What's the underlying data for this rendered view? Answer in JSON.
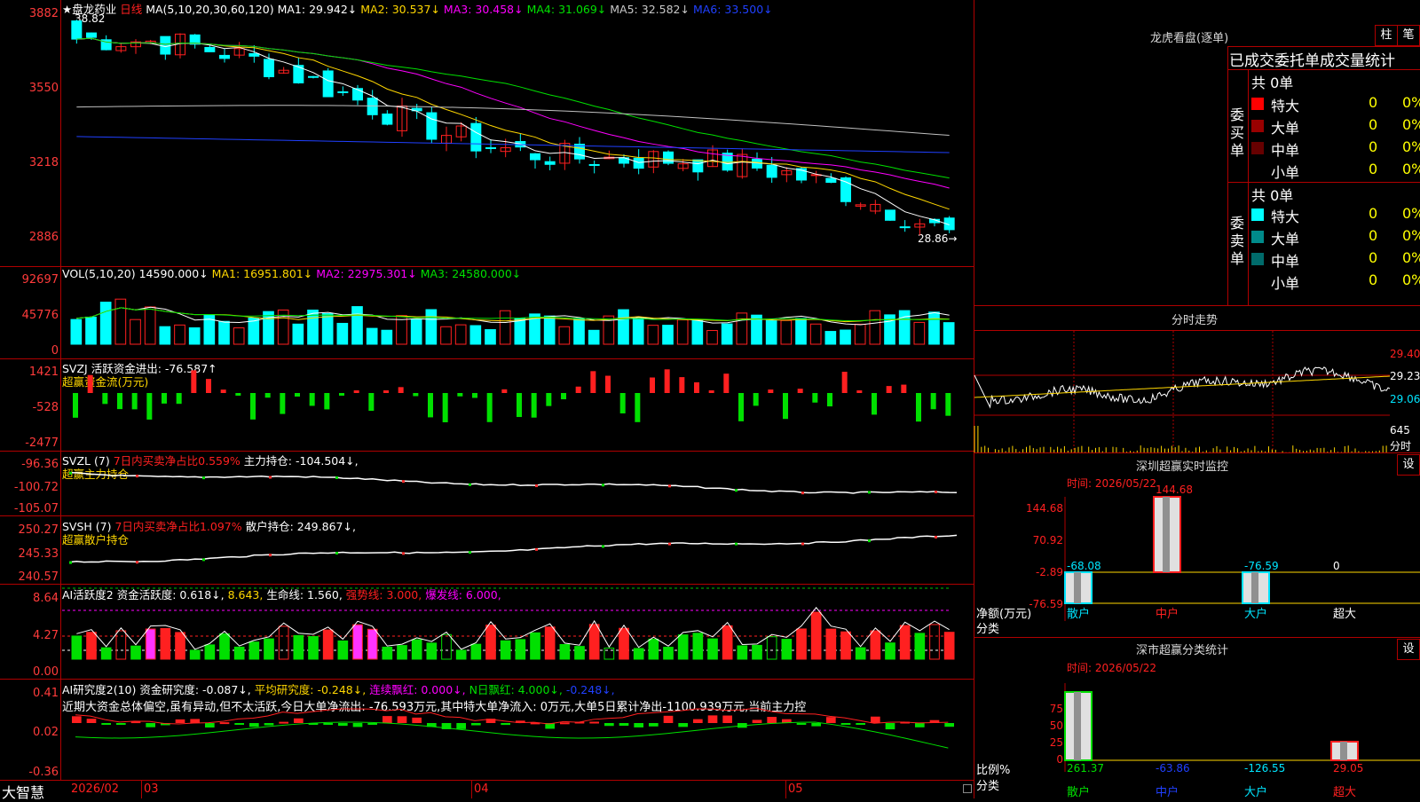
{
  "main_chart": {
    "stock_name": "★盘龙药业",
    "period": "日线",
    "ma_label": "MA(5,10,20,30,60,120)",
    "ma": [
      {
        "label": "MA1: 29.942↓",
        "color": "#ffffff"
      },
      {
        "label": "MA2: 30.537↓",
        "color": "#ffd700"
      },
      {
        "label": "MA3: 30.458↓",
        "color": "#ff00ff"
      },
      {
        "label": "MA4: 31.069↓",
        "color": "#00e000"
      },
      {
        "label": "MA5: 32.582↓",
        "color": "#c8c8c8"
      },
      {
        "label": "MA6: 33.500↓",
        "color": "#2040ff"
      }
    ],
    "yaxis": [
      "3882",
      "3550",
      "3218",
      "2886"
    ],
    "high_note": "38.82",
    "low_note": "28.86→"
  },
  "vol": {
    "label": "VOL(5,10,20)",
    "value": "14590.000↓",
    "ma1": "MA1: 16951.801↓",
    "ma2": "MA2: 22975.301↓",
    "ma3": "MA3: 24580.000↓",
    "yaxis": [
      "92697",
      "45776",
      "0"
    ]
  },
  "svzj": {
    "label": "SVZJ",
    "text": "活跃资金进出: -76.587↑",
    "sub": "超赢资金流(万元)",
    "yaxis": [
      "1421",
      "-528",
      "-2477"
    ]
  },
  "svzl": {
    "label": "SVZL (7)",
    "text1": "7日内买卖净占比0.559%",
    "text2": "主力持仓: -104.504↓,",
    "sub": "超赢主力持仓",
    "yaxis": [
      "-96.36",
      "-100.72",
      "-105.07"
    ]
  },
  "svsh": {
    "label": "SVSH (7)",
    "text1": "7日内买卖净占比1.097%",
    "text2": "散户持仓: 249.867↓,",
    "sub": "超赢散户持仓",
    "yaxis": [
      "250.27",
      "245.33",
      "240.57"
    ]
  },
  "ai1": {
    "label": "AI活跃度2",
    "t1": "资金活跃度: 0.618↓,",
    "t2": "8.643,",
    "t3": "生命线: 1.560,",
    "t4": "强势线: 3.000,",
    "t5": "爆发线: 6.000,",
    "yaxis": [
      "8.64",
      "4.27",
      "0.00"
    ]
  },
  "ai2": {
    "label": "AI研究度2(10)",
    "t1": "资金研究度: -0.087↓,",
    "t2": "平均研究度: -0.248↓,",
    "t3": "连续飘红: 0.000↓,",
    "t4": "N日飘红: 4.000↓,",
    "t5": "-0.248↓,",
    "desc": "近期大资金总体偏空,虽有异动,但不太活跃,今日大单净流出: -76.593万元,其中特大单净流入: 0万元,大单5日累计净出-1100.939万元,当前主力控",
    "yaxis": [
      "0.41",
      "0.02",
      "-0.36"
    ]
  },
  "bottom": {
    "brand": "大智慧",
    "dates": [
      "2026/02",
      "03",
      "04",
      "05"
    ]
  },
  "right": {
    "title": "龙虎看盘(逐单)",
    "btn1": "柱",
    "btn2": "笔",
    "stat_title": "已成交委托单成交量统计",
    "buy": {
      "side": "委买单",
      "total": "共 0单",
      "rows": [
        {
          "name": "特大",
          "count": "0",
          "pct": "0%",
          "color": "#ff0000"
        },
        {
          "name": "大单",
          "count": "0",
          "pct": "0%",
          "color": "#990000"
        },
        {
          "name": "中单",
          "count": "0",
          "pct": "0%",
          "color": "#660000"
        },
        {
          "name": "小单",
          "count": "0",
          "pct": "0%",
          "color": "#000000"
        }
      ]
    },
    "sell": {
      "side": "委卖单",
      "total": "共 0单",
      "rows": [
        {
          "name": "特大",
          "count": "0",
          "pct": "0%",
          "color": "#00ffff"
        },
        {
          "name": "大单",
          "count": "0",
          "pct": "0%",
          "color": "#008b8b"
        },
        {
          "name": "中单",
          "count": "0",
          "pct": "0%",
          "color": "#006b6b"
        },
        {
          "name": "小单",
          "count": "0",
          "pct": "0%",
          "color": "#000000"
        }
      ]
    },
    "intraday": {
      "title": "分时走势",
      "yaxis": [
        "29.40",
        "29.23",
        "29.06"
      ],
      "vol_label": "645",
      "vol_unit": "分时"
    },
    "monitor": {
      "title": "深圳超赢实时监控",
      "btn": "设",
      "time": "时间: 2026/05/22",
      "yaxis": [
        "144.68",
        "70.92",
        "-2.89",
        "-76.59"
      ],
      "left_label1": "净额(万元)",
      "left_label2": "分类",
      "values": [
        "-68.08",
        "144.68",
        "-76.59",
        "0"
      ],
      "cats": [
        "散户",
        "中户",
        "大户",
        "超大"
      ]
    },
    "classify": {
      "title": "深市超赢分类统计",
      "btn": "设",
      "time": "时间: 2026/05/22",
      "yaxis": [
        "75",
        "50",
        "25",
        "0"
      ],
      "left_label1": "比例%",
      "left_label2": "分类",
      "values": [
        "261.37",
        "-63.86",
        "-126.55",
        "29.05"
      ],
      "cats": [
        "散户",
        "中户",
        "大户",
        "超大"
      ]
    }
  }
}
